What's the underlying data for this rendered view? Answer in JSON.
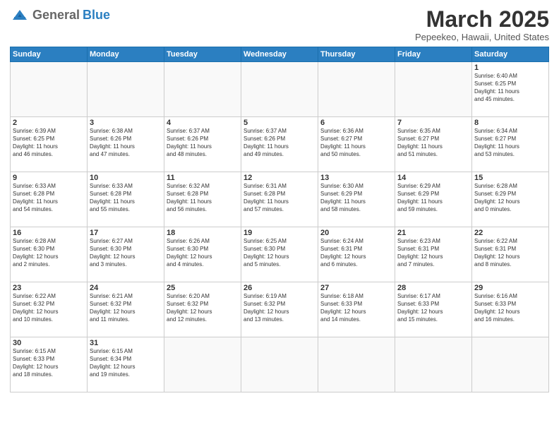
{
  "header": {
    "logo_general": "General",
    "logo_blue": "Blue",
    "title": "March 2025",
    "location": "Pepeekeo, Hawaii, United States"
  },
  "weekdays": [
    "Sunday",
    "Monday",
    "Tuesday",
    "Wednesday",
    "Thursday",
    "Friday",
    "Saturday"
  ],
  "weeks": [
    [
      {
        "day": "",
        "text": ""
      },
      {
        "day": "",
        "text": ""
      },
      {
        "day": "",
        "text": ""
      },
      {
        "day": "",
        "text": ""
      },
      {
        "day": "",
        "text": ""
      },
      {
        "day": "",
        "text": ""
      },
      {
        "day": "1",
        "text": "Sunrise: 6:40 AM\nSunset: 6:25 PM\nDaylight: 11 hours\nand 45 minutes."
      }
    ],
    [
      {
        "day": "2",
        "text": "Sunrise: 6:39 AM\nSunset: 6:25 PM\nDaylight: 11 hours\nand 46 minutes."
      },
      {
        "day": "3",
        "text": "Sunrise: 6:38 AM\nSunset: 6:26 PM\nDaylight: 11 hours\nand 47 minutes."
      },
      {
        "day": "4",
        "text": "Sunrise: 6:37 AM\nSunset: 6:26 PM\nDaylight: 11 hours\nand 48 minutes."
      },
      {
        "day": "5",
        "text": "Sunrise: 6:37 AM\nSunset: 6:26 PM\nDaylight: 11 hours\nand 49 minutes."
      },
      {
        "day": "6",
        "text": "Sunrise: 6:36 AM\nSunset: 6:27 PM\nDaylight: 11 hours\nand 50 minutes."
      },
      {
        "day": "7",
        "text": "Sunrise: 6:35 AM\nSunset: 6:27 PM\nDaylight: 11 hours\nand 51 minutes."
      },
      {
        "day": "8",
        "text": "Sunrise: 6:34 AM\nSunset: 6:27 PM\nDaylight: 11 hours\nand 53 minutes."
      }
    ],
    [
      {
        "day": "9",
        "text": "Sunrise: 6:33 AM\nSunset: 6:28 PM\nDaylight: 11 hours\nand 54 minutes."
      },
      {
        "day": "10",
        "text": "Sunrise: 6:33 AM\nSunset: 6:28 PM\nDaylight: 11 hours\nand 55 minutes."
      },
      {
        "day": "11",
        "text": "Sunrise: 6:32 AM\nSunset: 6:28 PM\nDaylight: 11 hours\nand 56 minutes."
      },
      {
        "day": "12",
        "text": "Sunrise: 6:31 AM\nSunset: 6:28 PM\nDaylight: 11 hours\nand 57 minutes."
      },
      {
        "day": "13",
        "text": "Sunrise: 6:30 AM\nSunset: 6:29 PM\nDaylight: 11 hours\nand 58 minutes."
      },
      {
        "day": "14",
        "text": "Sunrise: 6:29 AM\nSunset: 6:29 PM\nDaylight: 11 hours\nand 59 minutes."
      },
      {
        "day": "15",
        "text": "Sunrise: 6:28 AM\nSunset: 6:29 PM\nDaylight: 12 hours\nand 0 minutes."
      }
    ],
    [
      {
        "day": "16",
        "text": "Sunrise: 6:28 AM\nSunset: 6:30 PM\nDaylight: 12 hours\nand 2 minutes."
      },
      {
        "day": "17",
        "text": "Sunrise: 6:27 AM\nSunset: 6:30 PM\nDaylight: 12 hours\nand 3 minutes."
      },
      {
        "day": "18",
        "text": "Sunrise: 6:26 AM\nSunset: 6:30 PM\nDaylight: 12 hours\nand 4 minutes."
      },
      {
        "day": "19",
        "text": "Sunrise: 6:25 AM\nSunset: 6:30 PM\nDaylight: 12 hours\nand 5 minutes."
      },
      {
        "day": "20",
        "text": "Sunrise: 6:24 AM\nSunset: 6:31 PM\nDaylight: 12 hours\nand 6 minutes."
      },
      {
        "day": "21",
        "text": "Sunrise: 6:23 AM\nSunset: 6:31 PM\nDaylight: 12 hours\nand 7 minutes."
      },
      {
        "day": "22",
        "text": "Sunrise: 6:22 AM\nSunset: 6:31 PM\nDaylight: 12 hours\nand 8 minutes."
      }
    ],
    [
      {
        "day": "23",
        "text": "Sunrise: 6:22 AM\nSunset: 6:32 PM\nDaylight: 12 hours\nand 10 minutes."
      },
      {
        "day": "24",
        "text": "Sunrise: 6:21 AM\nSunset: 6:32 PM\nDaylight: 12 hours\nand 11 minutes."
      },
      {
        "day": "25",
        "text": "Sunrise: 6:20 AM\nSunset: 6:32 PM\nDaylight: 12 hours\nand 12 minutes."
      },
      {
        "day": "26",
        "text": "Sunrise: 6:19 AM\nSunset: 6:32 PM\nDaylight: 12 hours\nand 13 minutes."
      },
      {
        "day": "27",
        "text": "Sunrise: 6:18 AM\nSunset: 6:33 PM\nDaylight: 12 hours\nand 14 minutes."
      },
      {
        "day": "28",
        "text": "Sunrise: 6:17 AM\nSunset: 6:33 PM\nDaylight: 12 hours\nand 15 minutes."
      },
      {
        "day": "29",
        "text": "Sunrise: 6:16 AM\nSunset: 6:33 PM\nDaylight: 12 hours\nand 16 minutes."
      }
    ],
    [
      {
        "day": "30",
        "text": "Sunrise: 6:15 AM\nSunset: 6:33 PM\nDaylight: 12 hours\nand 18 minutes."
      },
      {
        "day": "31",
        "text": "Sunrise: 6:15 AM\nSunset: 6:34 PM\nDaylight: 12 hours\nand 19 minutes."
      },
      {
        "day": "",
        "text": ""
      },
      {
        "day": "",
        "text": ""
      },
      {
        "day": "",
        "text": ""
      },
      {
        "day": "",
        "text": ""
      },
      {
        "day": "",
        "text": ""
      }
    ]
  ]
}
